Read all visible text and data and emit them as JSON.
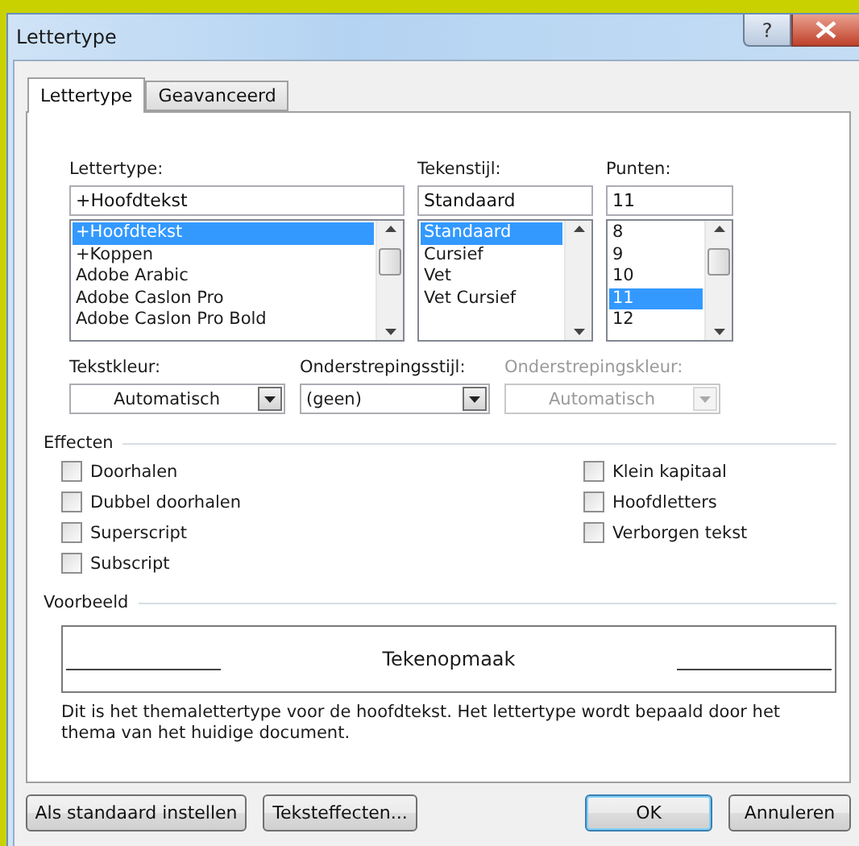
{
  "window": {
    "title": "Lettertype",
    "help_button": "?"
  },
  "tabs": [
    {
      "label": "Lettertype",
      "selected": true
    },
    {
      "label": "Geavanceerd",
      "selected": false
    }
  ],
  "font": {
    "label": "Lettertype:",
    "value": "+Hoofdtekst",
    "items": [
      {
        "label": "+Hoofdtekst",
        "selected": true
      },
      {
        "label": "+Koppen",
        "selected": false
      },
      {
        "label": "Adobe Arabic",
        "selected": false
      },
      {
        "label": "Adobe Caslon Pro",
        "selected": false
      },
      {
        "label": "Adobe Caslon Pro Bold",
        "selected": false
      }
    ]
  },
  "style": {
    "label": "Tekenstijl:",
    "value": "Standaard",
    "items": [
      {
        "label": "Standaard",
        "selected": true
      },
      {
        "label": "Cursief",
        "selected": false
      },
      {
        "label": "Vet",
        "selected": false
      },
      {
        "label": "Vet Cursief",
        "selected": false
      }
    ]
  },
  "size": {
    "label": "Punten:",
    "value": "11",
    "items": [
      {
        "label": "8",
        "selected": false
      },
      {
        "label": "9",
        "selected": false
      },
      {
        "label": "10",
        "selected": false
      },
      {
        "label": "11",
        "selected": true
      },
      {
        "label": "12",
        "selected": false
      }
    ]
  },
  "dropdowns": [
    {
      "label": "Tekstkleur:",
      "value": "Automatisch",
      "disabled": false,
      "centered": true
    },
    {
      "label": "Onderstrepingsstijl:",
      "value": "(geen)",
      "disabled": false,
      "centered": false
    },
    {
      "label": "Onderstrepingskleur:",
      "value": "Automatisch",
      "disabled": true,
      "centered": true
    }
  ],
  "effects": {
    "title": "Effecten",
    "columns": [
      [
        {
          "label": "Doorhalen",
          "checked": false
        },
        {
          "label": "Dubbel doorhalen",
          "checked": false
        },
        {
          "label": "Superscript",
          "checked": false
        },
        {
          "label": "Subscript",
          "checked": false
        }
      ],
      [
        {
          "label": "Klein kapitaal",
          "checked": false
        },
        {
          "label": "Hoofdletters",
          "checked": false
        },
        {
          "label": "Verborgen tekst",
          "checked": false
        }
      ]
    ]
  },
  "preview": {
    "title": "Voorbeeld",
    "sample": "Tekenopmaak",
    "description": "Dit is het themalettertype voor de hoofdtekst. Het lettertype wordt bepaald door het thema van het huidige document."
  },
  "buttons": [
    {
      "label": "Als standaard instellen",
      "default": false
    },
    {
      "label": "Teksteffecten...",
      "default": false
    },
    {
      "label": "OK",
      "default": true
    },
    {
      "label": "Annuleren",
      "default": false
    }
  ]
}
